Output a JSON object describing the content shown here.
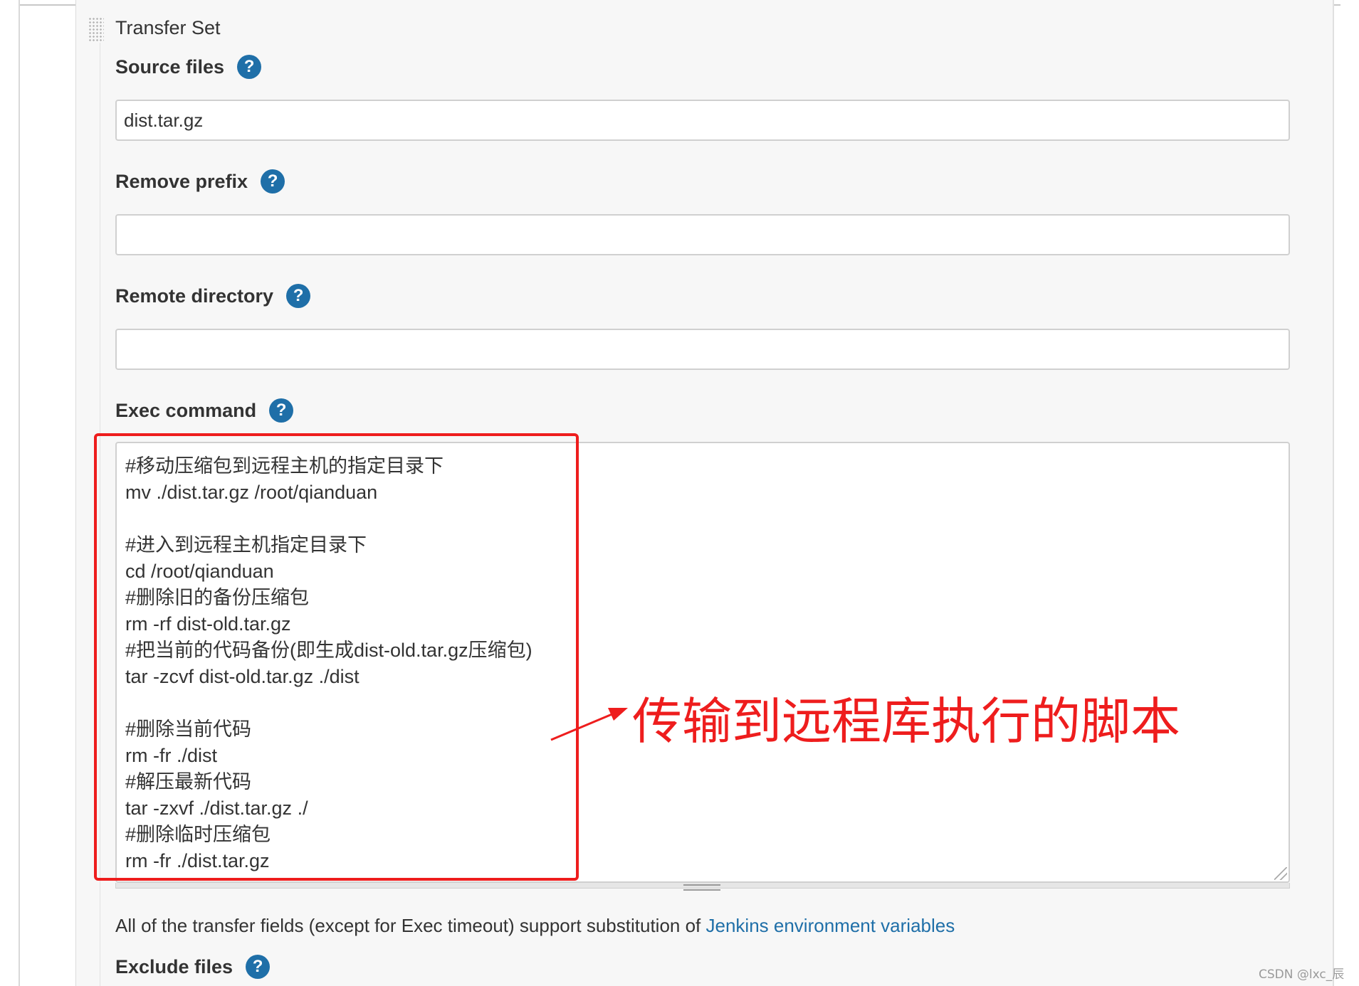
{
  "section": {
    "title": "Transfer Set"
  },
  "fields": {
    "source_files": {
      "label": "Source files",
      "value": "dist.tar.gz"
    },
    "remove_prefix": {
      "label": "Remove prefix",
      "value": ""
    },
    "remote_directory": {
      "label": "Remote directory",
      "value": ""
    },
    "exec_command": {
      "label": "Exec command",
      "lines": [
        "#移动压缩包到远程主机的指定目录下",
        "mv ./dist.tar.gz /root/qianduan",
        "",
        "#进入到远程主机指定目录下",
        "cd /root/qianduan",
        "#删除旧的备份压缩包",
        "rm -rf dist-old.tar.gz",
        "#把当前的代码备份(即生成dist-old.tar.gz压缩包)",
        "tar -zcvf dist-old.tar.gz ./dist",
        "",
        "#删除当前代码",
        "rm -fr ./dist",
        "#解压最新代码",
        "tar -zxvf ./dist.tar.gz ./",
        "#删除临时压缩包",
        "rm -fr ./dist.tar.gz"
      ]
    },
    "exclude_files": {
      "label": "Exclude files"
    }
  },
  "help_glyph": "?",
  "info": {
    "text": "All of the transfer fields (except for Exec timeout) support substitution of ",
    "link": "Jenkins environment variables"
  },
  "annotation": {
    "text": "传输到远程库执行的脚本",
    "color": "#ee1d1d"
  },
  "watermark": "CSDN @lxc_辰",
  "colors": {
    "help_icon": "#1f6fa8",
    "link": "#1f6fa8",
    "annotation": "#ee1d1d"
  }
}
